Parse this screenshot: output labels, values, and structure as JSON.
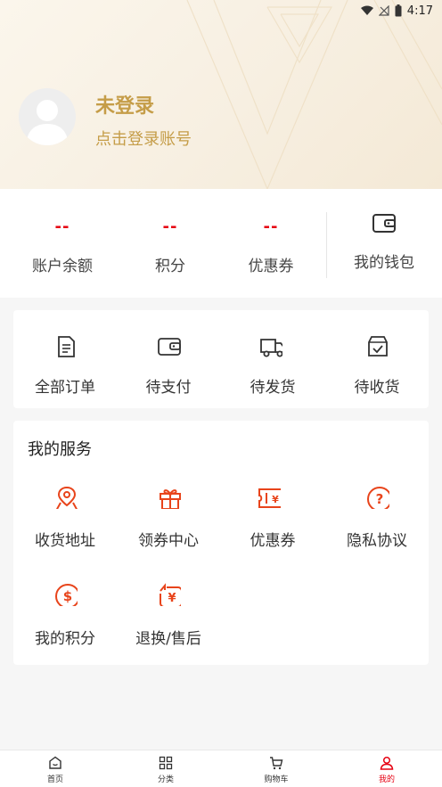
{
  "status_bar": {
    "time": "4:17"
  },
  "user": {
    "name": "未登录",
    "prompt": "点击登录账号"
  },
  "assets": [
    {
      "value": "--",
      "label": "账户余额"
    },
    {
      "value": "--",
      "label": "积分"
    },
    {
      "value": "--",
      "label": "优惠券"
    }
  ],
  "wallet": {
    "label": "我的钱包",
    "icon": "wallet-icon"
  },
  "orders": [
    {
      "label": "全部订单",
      "icon": "document-icon"
    },
    {
      "label": "待支付",
      "icon": "wallet-icon"
    },
    {
      "label": "待发货",
      "icon": "truck-icon"
    },
    {
      "label": "待收货",
      "icon": "package-check-icon"
    }
  ],
  "services": {
    "title": "我的服务",
    "items": [
      {
        "label": "收货地址",
        "icon": "map-pin-icon"
      },
      {
        "label": "领券中心",
        "icon": "gift-icon"
      },
      {
        "label": "优惠券",
        "icon": "coupon-icon"
      },
      {
        "label": "隐私协议",
        "icon": "question-icon"
      },
      {
        "label": "我的积分",
        "icon": "dollar-coin-icon"
      },
      {
        "label": "退换/售后",
        "icon": "refund-icon"
      }
    ]
  },
  "tabs": [
    {
      "label": "首页",
      "icon": "home-icon",
      "active": false
    },
    {
      "label": "分类",
      "icon": "grid-icon",
      "active": false
    },
    {
      "label": "购物车",
      "icon": "cart-icon",
      "active": false
    },
    {
      "label": "我的",
      "icon": "user-icon",
      "active": true
    }
  ],
  "colors": {
    "accent": "#e60012",
    "gold": "#c59d48",
    "service_icon": "#e8441b"
  }
}
